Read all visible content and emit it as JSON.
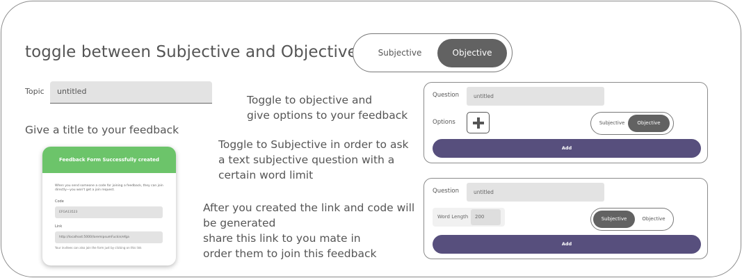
{
  "heading": "toggle between Subjective and Objective",
  "big_toggle": {
    "left": "Subjective",
    "right": "Objective",
    "selected": "Objective"
  },
  "topic": {
    "label": "Topic",
    "value": "untitled"
  },
  "notes": {
    "title_hint": "Give a title to your feedback",
    "objective_hint": [
      "Toggle to objective and",
      "give options to your feedback"
    ],
    "subjective_hint": [
      "Toggle to Subjective in order to ask",
      "a text subjective question with a",
      "certain word limit"
    ],
    "link_hint": [
      "After you created the link and code will",
      "be generated",
      "share this link to you mate in",
      "order them to join this feedback"
    ]
  },
  "success_card": {
    "banner": "Feedback Form Successfully created",
    "description": "When you send someone a code for joining a feedback, they can join directly—you won't get a join request.",
    "code_label": "Code",
    "code_value": "EFGA13523",
    "link_label": "Link",
    "link_value": "http://localhost:5000/loremipsumFuckin/efga",
    "footer": "Your invitees can also join the form just by clicking on this link"
  },
  "objective_card": {
    "question_label": "Question",
    "question_value": "untitled",
    "options_label": "Options",
    "toggle": {
      "left": "Subjective",
      "right": "Objective",
      "selected": "Objective"
    },
    "add_label": "Add"
  },
  "subjective_card": {
    "question_label": "Question",
    "question_value": "untitled",
    "word_length_label": "Word Length",
    "word_length_value": "200",
    "toggle": {
      "left": "Subjective",
      "right": "Objective",
      "selected": "Subjective"
    },
    "add_label": "Add"
  },
  "colors": {
    "accent": "#574f7d",
    "success": "#6cc46a",
    "toggle_active": "#626262"
  }
}
